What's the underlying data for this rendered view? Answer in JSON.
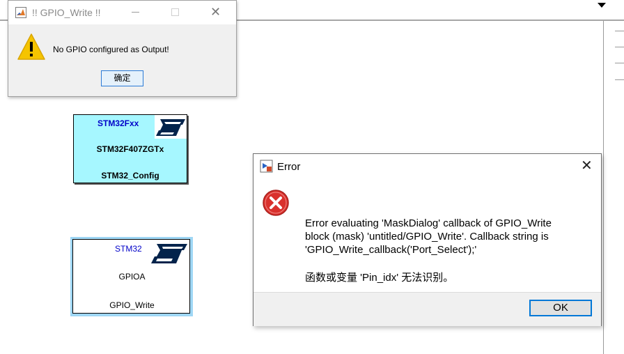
{
  "canvas": {
    "blocks": [
      {
        "family": "STM32Fxx",
        "chip": "STM32F407ZGTx",
        "name": "STM32_Config",
        "logo": "st-logo",
        "fill": "#a6f7ff"
      },
      {
        "family": "STM32",
        "port": "GPIOA",
        "name": "GPIO_Write",
        "logo": "st-logo",
        "selected": true
      }
    ]
  },
  "gpio_dialog": {
    "title": "!! GPIO_Write !!",
    "message": "No GPIO configured as Output!",
    "ok_label": "确定",
    "icons": {
      "app": "matlab-icon",
      "warning": "warning-icon",
      "minimize": "minimize-icon",
      "maximize": "maximize-icon",
      "close": "close-icon"
    }
  },
  "error_dialog": {
    "title": "Error",
    "message": "Error evaluating 'MaskDialog' callback of GPIO_Write\nblock (mask) 'untitled/GPIO_Write'. Callback string is\n'GPIO_Write_callback('Port_Select');'",
    "detail": "函数或变量 'Pin_idx' 无法识别。",
    "ok_label": "OK",
    "icons": {
      "app": "simulink-icon",
      "error": "error-icon",
      "close": "close-icon"
    }
  },
  "colors": {
    "accent": "#0078d7",
    "error": "#d9302c",
    "warning": "#f5c400",
    "block_fill": "#a6f7ff",
    "st_blue": "#03234b"
  }
}
